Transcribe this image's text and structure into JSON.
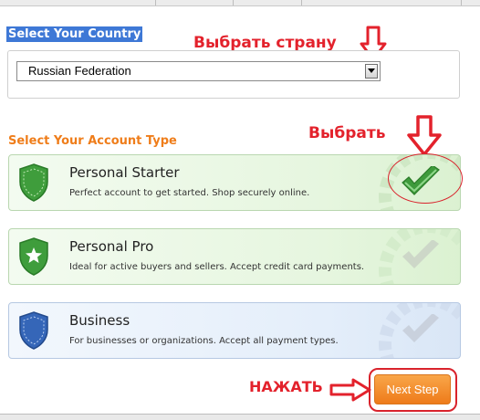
{
  "country_section": {
    "heading": "Select Your Country",
    "selected_country": "Russian Federation"
  },
  "account_section": {
    "heading": "Select Your Account Type",
    "options": [
      {
        "title": "Personal Starter",
        "description": "Perfect account to get started. Shop securely online.",
        "selected": true,
        "shield_color": "#3a9a3a"
      },
      {
        "title": "Personal Pro",
        "description": "Ideal for active buyers and sellers. Accept credit card payments.",
        "selected": false,
        "shield_color": "#3a9a3a"
      },
      {
        "title": "Business",
        "description": "For businesses or organizations. Accept all payment types.",
        "selected": false,
        "shield_color": "#3566b8"
      }
    ]
  },
  "annotations": {
    "choose_country": "Выбрать страну",
    "choose": "Выбрать",
    "press": "НАЖАТЬ"
  },
  "next_button": {
    "label": "Next Step"
  },
  "colors": {
    "annotation_red": "#e3222c",
    "heading_orange": "#ef7d1a",
    "button_orange": "#ee7b1a",
    "selection_blue": "#3e78d6"
  }
}
